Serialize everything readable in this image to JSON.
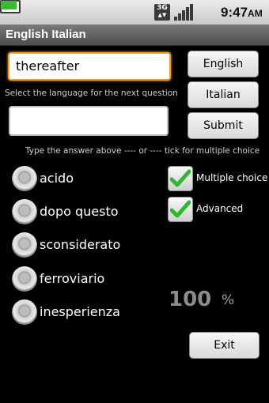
{
  "status_bar": {
    "time": "9:47",
    "ampm": "AM",
    "network": "3G"
  },
  "app": {
    "title": "English Italian"
  },
  "word_input": {
    "value": "thereafter"
  },
  "hints": {
    "language": "Select the language for the next question",
    "answer": "Type the answer above ---- or ---- tick for multiple choice"
  },
  "answer_input": {
    "value": ""
  },
  "buttons": {
    "english": "English",
    "italian": "Italian",
    "submit": "Submit",
    "exit": "Exit"
  },
  "choices": [
    {
      "label": "acido",
      "selected": false
    },
    {
      "label": "dopo questo",
      "selected": false
    },
    {
      "label": "sconsiderato",
      "selected": false
    },
    {
      "label": "ferroviario",
      "selected": false
    },
    {
      "label": "inesperienza",
      "selected": false
    }
  ],
  "options": {
    "multiple_choice": {
      "label": "Multiple choice",
      "checked": true
    },
    "advanced": {
      "label": "Advanced",
      "checked": true
    }
  },
  "score": {
    "value": "100",
    "unit": "%"
  },
  "colors": {
    "focus": "#f39a19",
    "check": "#2eb82e"
  }
}
